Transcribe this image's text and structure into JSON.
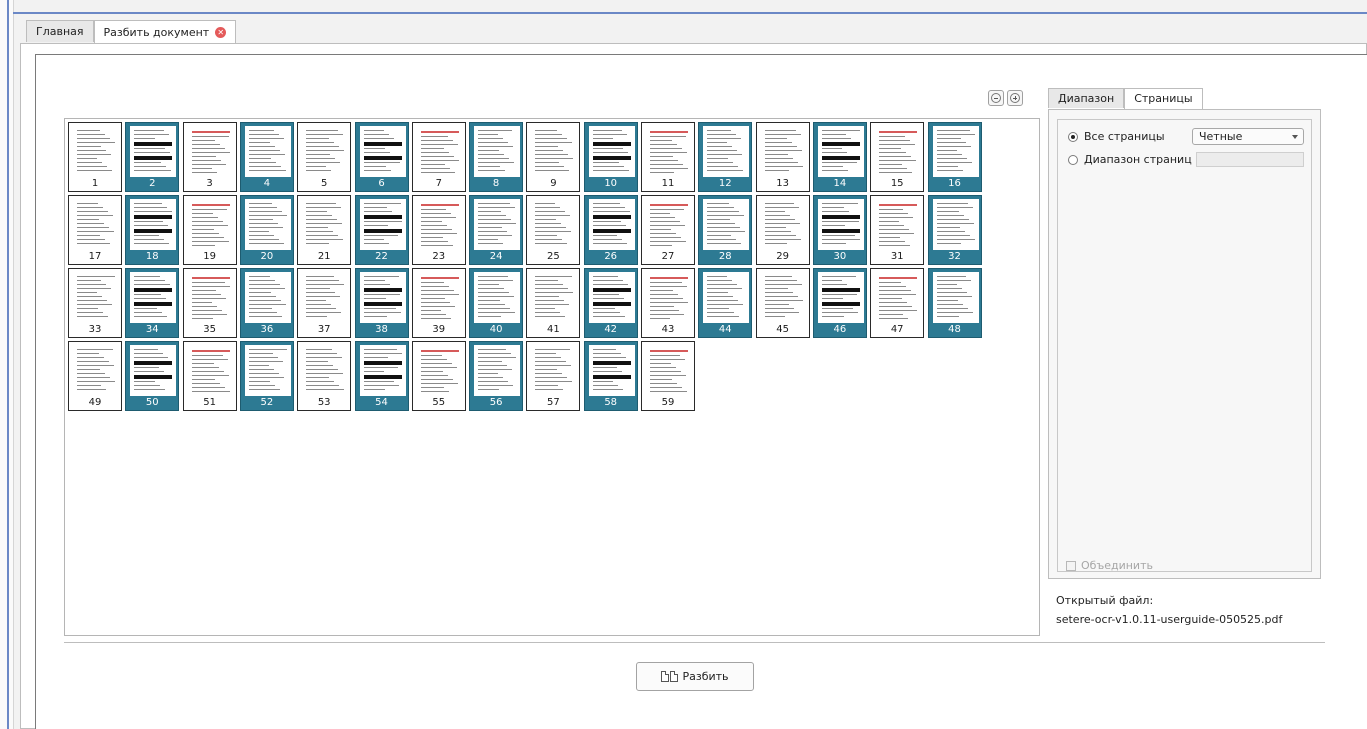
{
  "tabs": [
    {
      "label": "Главная"
    },
    {
      "label": "Разбить документ"
    }
  ],
  "right_panel": {
    "tabs": [
      {
        "label": "Диапазон"
      },
      {
        "label": "Страницы"
      }
    ],
    "all_pages_label": "Все страницы",
    "range_label": "Диапазон страниц",
    "filter_value": "Четные",
    "range_value": "",
    "merge_label": "Объединить"
  },
  "file": {
    "label": "Открытый файл:",
    "name": "setere-ocr-v1.0.11-userguide-050525.pdf"
  },
  "split_button_label": "Разбить",
  "pages": [
    {
      "num": "1",
      "selected": false
    },
    {
      "num": "2",
      "selected": true
    },
    {
      "num": "3",
      "selected": false
    },
    {
      "num": "4",
      "selected": true
    },
    {
      "num": "5",
      "selected": false
    },
    {
      "num": "6",
      "selected": true
    },
    {
      "num": "7",
      "selected": false
    },
    {
      "num": "8",
      "selected": true
    },
    {
      "num": "9",
      "selected": false
    },
    {
      "num": "10",
      "selected": true
    },
    {
      "num": "11",
      "selected": false
    },
    {
      "num": "12",
      "selected": true
    },
    {
      "num": "13",
      "selected": false
    },
    {
      "num": "14",
      "selected": true
    },
    {
      "num": "15",
      "selected": false
    },
    {
      "num": "16",
      "selected": true
    },
    {
      "num": "17",
      "selected": false
    },
    {
      "num": "18",
      "selected": true
    },
    {
      "num": "19",
      "selected": false
    },
    {
      "num": "20",
      "selected": true
    },
    {
      "num": "21",
      "selected": false
    },
    {
      "num": "22",
      "selected": true
    },
    {
      "num": "23",
      "selected": false
    },
    {
      "num": "24",
      "selected": true
    },
    {
      "num": "25",
      "selected": false
    },
    {
      "num": "26",
      "selected": true
    },
    {
      "num": "27",
      "selected": false
    },
    {
      "num": "28",
      "selected": true
    },
    {
      "num": "29",
      "selected": false
    },
    {
      "num": "30",
      "selected": true
    },
    {
      "num": "31",
      "selected": false
    },
    {
      "num": "32",
      "selected": true
    },
    {
      "num": "33",
      "selected": false
    },
    {
      "num": "34",
      "selected": true
    },
    {
      "num": "35",
      "selected": false
    },
    {
      "num": "36",
      "selected": true
    },
    {
      "num": "37",
      "selected": false
    },
    {
      "num": "38",
      "selected": true
    },
    {
      "num": "39",
      "selected": false
    },
    {
      "num": "40",
      "selected": true
    },
    {
      "num": "41",
      "selected": false
    },
    {
      "num": "42",
      "selected": true
    },
    {
      "num": "43",
      "selected": false
    },
    {
      "num": "44",
      "selected": true
    },
    {
      "num": "45",
      "selected": false
    },
    {
      "num": "46",
      "selected": true
    },
    {
      "num": "47",
      "selected": false
    },
    {
      "num": "48",
      "selected": true
    },
    {
      "num": "49",
      "selected": false
    },
    {
      "num": "50",
      "selected": true
    },
    {
      "num": "51",
      "selected": false
    },
    {
      "num": "52",
      "selected": true
    },
    {
      "num": "53",
      "selected": false
    },
    {
      "num": "54",
      "selected": true
    },
    {
      "num": "55",
      "selected": false
    },
    {
      "num": "56",
      "selected": true
    },
    {
      "num": "57",
      "selected": false
    },
    {
      "num": "58",
      "selected": true
    },
    {
      "num": "59",
      "selected": false
    }
  ]
}
